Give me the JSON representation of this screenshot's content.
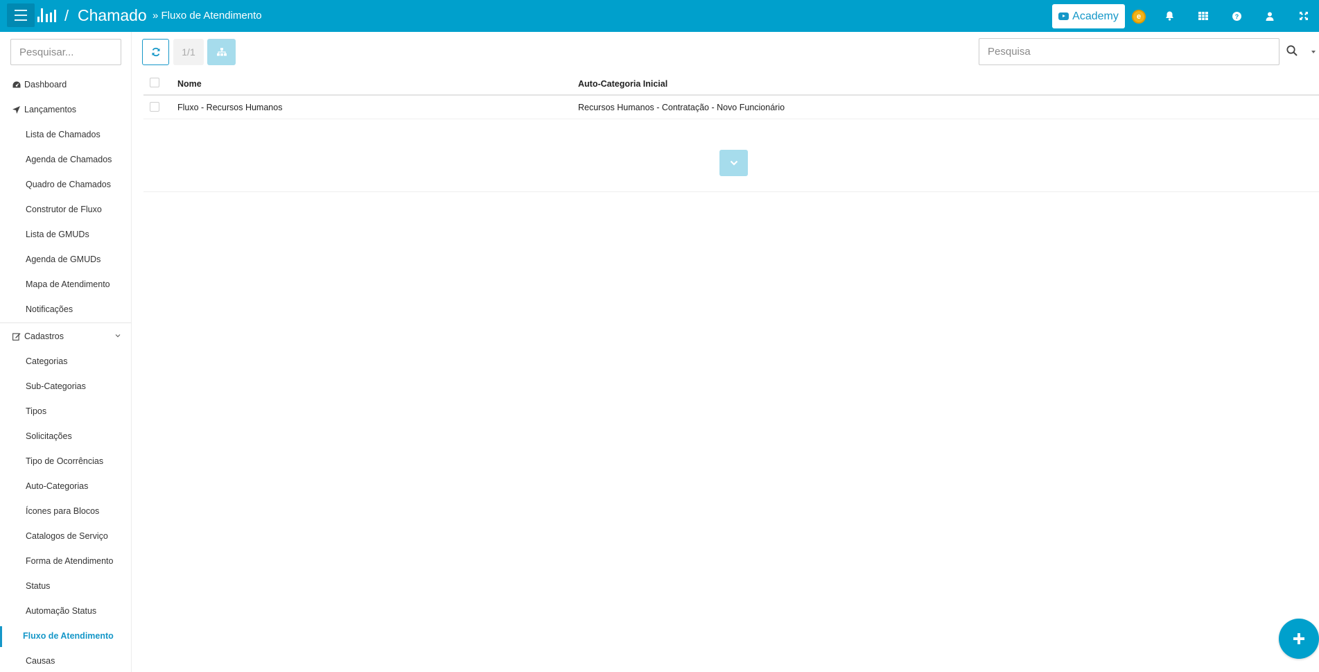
{
  "header": {
    "app_title": "Chamado",
    "separator": "/",
    "breadcrumb": "» Fluxo de Atendimento",
    "academy_label": "Academy",
    "coin_label": "e"
  },
  "sidebar": {
    "search_placeholder": "Pesquisar...",
    "items": [
      {
        "label": "Dashboard",
        "icon": "dashboard-icon",
        "level": "top"
      },
      {
        "label": "Lançamentos",
        "icon": "location-arrow-icon",
        "level": "top"
      },
      {
        "label": "Lista de Chamados",
        "level": "sub"
      },
      {
        "label": "Agenda de Chamados",
        "level": "sub"
      },
      {
        "label": "Quadro de Chamados",
        "level": "sub"
      },
      {
        "label": "Construtor de Fluxo",
        "level": "sub"
      },
      {
        "label": "Lista de GMUDs",
        "level": "sub"
      },
      {
        "label": "Agenda de GMUDs",
        "level": "sub"
      },
      {
        "label": "Mapa de Atendimento",
        "level": "sub"
      },
      {
        "label": "Notificações",
        "level": "sub"
      },
      {
        "label": "Cadastros",
        "icon": "edit-icon",
        "level": "top"
      },
      {
        "label": "Categorias",
        "level": "sub"
      },
      {
        "label": "Sub-Categorias",
        "level": "sub"
      },
      {
        "label": "Tipos",
        "level": "sub"
      },
      {
        "label": "Solicitações",
        "level": "sub"
      },
      {
        "label": "Tipo de Ocorrências",
        "level": "sub"
      },
      {
        "label": "Auto-Categorias",
        "level": "sub"
      },
      {
        "label": "Ícones para Blocos",
        "level": "sub"
      },
      {
        "label": "Catalogos de Serviço",
        "level": "sub"
      },
      {
        "label": "Forma de Atendimento",
        "level": "sub"
      },
      {
        "label": "Status",
        "level": "sub"
      },
      {
        "label": "Automação Status",
        "level": "sub"
      },
      {
        "label": "Fluxo de Atendimento",
        "level": "sub",
        "active": true
      },
      {
        "label": "Causas",
        "level": "sub"
      }
    ]
  },
  "toolbar": {
    "pagination": "1/1",
    "search_placeholder": "Pesquisa"
  },
  "table": {
    "columns": [
      "Nome",
      "Auto-Categoria Inicial"
    ],
    "rows": [
      [
        "Fluxo - Recursos Humanos",
        "Recursos Humanos - Contratação - Novo Funcionário"
      ]
    ]
  },
  "colors": {
    "primary": "#00a0cc",
    "accent": "#1597c8",
    "disabled_button": "#a6dcec",
    "coin": "#f2b31b"
  }
}
